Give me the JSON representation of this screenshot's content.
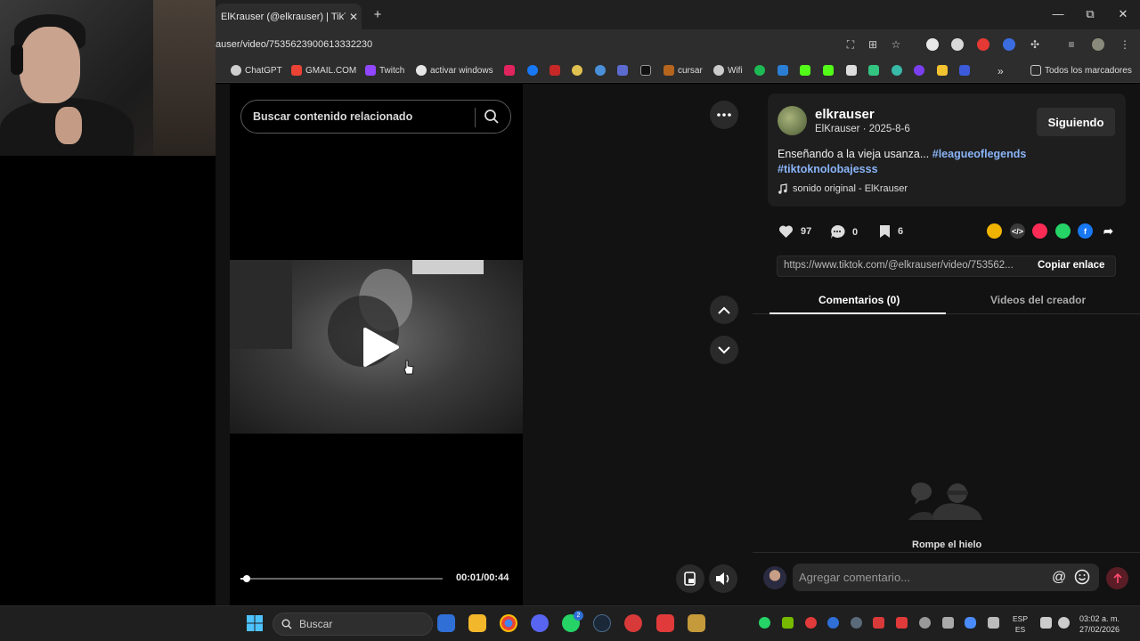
{
  "browser": {
    "tab_title": "ElKrauser (@elkrauser) | TikTok",
    "tab_close": "✕",
    "new_tab": "+",
    "window_controls": [
      "—",
      "⧉",
      "✕"
    ],
    "url": "auser/video/7535623900613332230",
    "bookmarks": [
      {
        "label": "ChatGPT",
        "icon": "chatgpt-icon",
        "color": "#cfcfcf"
      },
      {
        "label": "GMAIL.COM",
        "icon": "gmail-icon",
        "color": "#ea4335"
      },
      {
        "label": "Twitch",
        "icon": "twitch-icon",
        "color": "#9146ff"
      },
      {
        "label": "activar windows",
        "icon": "github-icon",
        "color": "#e6e6e6"
      },
      {
        "label": "cursar",
        "icon": "cursar-icon",
        "color": "#b5651d"
      },
      {
        "label": "Wifi",
        "icon": "globe-icon",
        "color": "#cccccc"
      }
    ],
    "bookmarks_overflow": "»",
    "all_bookmarks": "Todos los marcadores"
  },
  "video": {
    "search_placeholder": "Buscar contenido relacionado",
    "progress_fraction": 0.023,
    "time": "00:01/00:44"
  },
  "post": {
    "display_name": "elkrauser",
    "subtitle": "ElKrauser · 2025-8-6",
    "follow_label": "Siguiendo",
    "caption": "Enseñando a la vieja usanza...",
    "hashtags": [
      "#leagueoflegends",
      "#tiktoknolobajesss"
    ],
    "sound": "sonido original - ElKrauser",
    "likes": "97",
    "comments": "0",
    "saves": "6",
    "share_colors": [
      "#f0b400",
      "#3a3a3a",
      "#fe2c55",
      "#25d366",
      "#1877f2"
    ],
    "link": "https://www.tiktok.com/@elkrauser/video/753562...",
    "copy_link_label": "Copiar enlace",
    "tabs": [
      "Comentarios (0)",
      "Videos del creador"
    ],
    "empty_title": "Rompe el hielo",
    "comment_placeholder": "Agregar comentario...",
    "at_symbol": "@"
  },
  "taskbar": {
    "search_label": "Buscar",
    "lang_top": "ESP",
    "lang_bottom": "ES",
    "time": "03:02 a. m.",
    "date": "27/02/2026",
    "badge_count": "2"
  }
}
